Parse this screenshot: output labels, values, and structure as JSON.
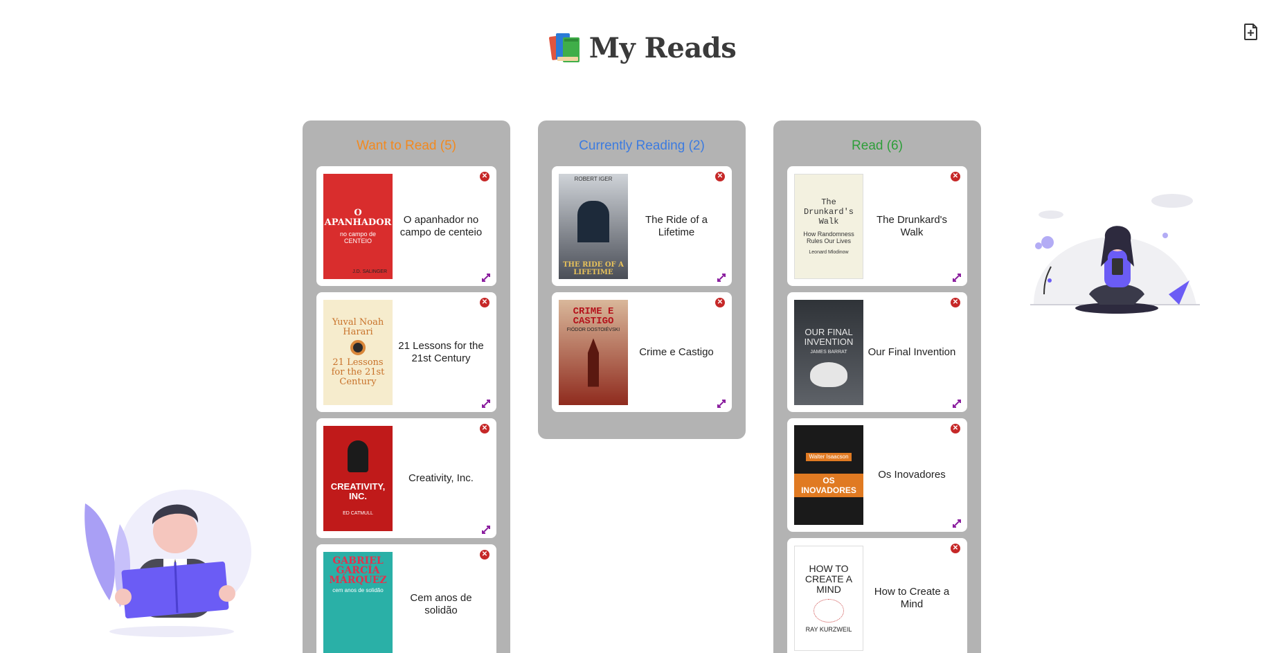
{
  "header": {
    "title": "My Reads"
  },
  "colors": {
    "want": "#f2891f",
    "current": "#3c7be0",
    "read": "#2e9e3a",
    "column_bg": "#b3b3b3",
    "remove": "#c62828",
    "move": "#8a1d9e"
  },
  "columns": {
    "want": {
      "title": "Want to Read (5)",
      "books": [
        {
          "title": "O apanhador no campo de centeio",
          "cover_top": "O APANHADOR",
          "cover_mid": "no campo de CENTEIO",
          "cover_author": "J.D. SALINGER"
        },
        {
          "title": "21 Lessons for the 21st Century",
          "cover_top": "Yuval Noah Harari",
          "cover_mid": "21 Lessons for the 21st Century",
          "cover_author": ""
        },
        {
          "title": "Creativity, Inc.",
          "cover_top": "CREATIVITY, INC.",
          "cover_mid": "",
          "cover_author": "ED CATMULL"
        },
        {
          "title": "Cem anos de solidão",
          "cover_top": "GABRIEL GARCÍA MÁRQUEZ",
          "cover_mid": "cem anos de solidão",
          "cover_author": ""
        }
      ]
    },
    "current": {
      "title": "Currently Reading (2)",
      "books": [
        {
          "title": "The Ride of a Lifetime",
          "cover_top": "ROBERT IGER",
          "cover_mid": "THE RIDE OF A LIFETIME",
          "cover_author": ""
        },
        {
          "title": "Crime e Castigo",
          "cover_top": "CRIME E CASTIGO",
          "cover_mid": "FIÓDOR DOSTOIÉVSKI",
          "cover_author": ""
        }
      ]
    },
    "read": {
      "title": "Read (6)",
      "books": [
        {
          "title": "The Drunkard's Walk",
          "cover_top": "The Drunkard's Walk",
          "cover_mid": "How Randomness Rules Our Lives",
          "cover_author": "Leonard Mlodinow"
        },
        {
          "title": "Our Final Invention",
          "cover_top": "OUR FINAL INVENTION",
          "cover_mid": "JAMES BARRAT",
          "cover_author": ""
        },
        {
          "title": "Os Inovadores",
          "cover_top": "Walter Isaacson",
          "cover_mid": "OS INOVADORES",
          "cover_author": ""
        },
        {
          "title": "How to Create a Mind",
          "cover_top": "HOW TO CREATE A MIND",
          "cover_mid": "",
          "cover_author": "RAY KURZWEIL"
        }
      ]
    }
  },
  "icons": {
    "logo": "books-icon",
    "add": "add-document-icon",
    "remove": "close-circle-icon",
    "move": "move-arrows-icon"
  }
}
